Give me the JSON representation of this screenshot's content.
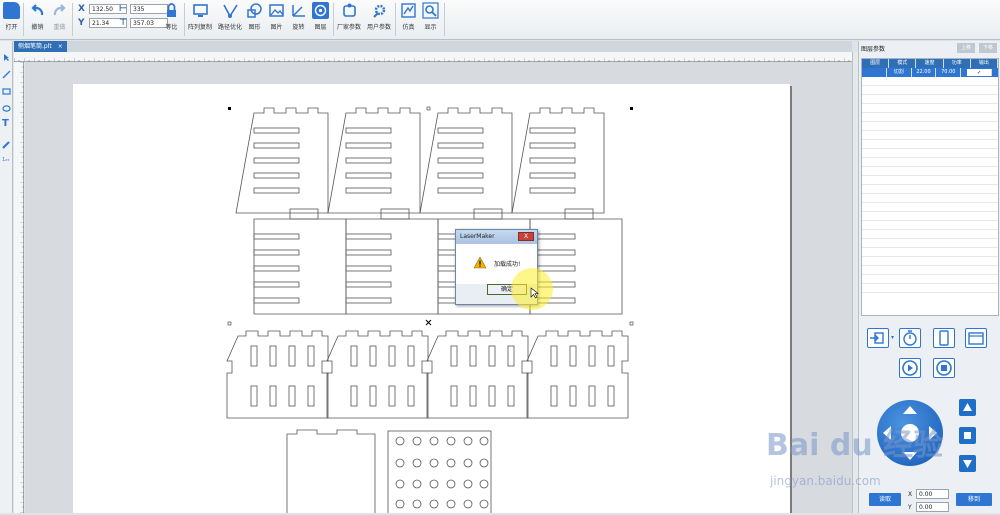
{
  "toolbar": {
    "open": "打开",
    "undo": "撤销",
    "redo": "重做",
    "x_value": "132.50",
    "y_value": "21.34",
    "w_value": "335",
    "h_value": "357.03",
    "lock": "等比",
    "array_copy": "阵列复制",
    "path_optimize": "路径优化",
    "shape": "图形",
    "image": "图片",
    "rotate": "旋转",
    "layer": "图层",
    "vendor_params": "厂家参数",
    "user_params": "用户参数",
    "simulate": "仿真",
    "display": "显示",
    "x_label": "X",
    "y_label": "Y",
    "w_label": "W",
    "h_label": "H"
  },
  "tab": {
    "name": "侧烟笔筒.plt",
    "close": "×"
  },
  "dialog": {
    "title": "LaserMaker",
    "message": "加载成功!",
    "ok": "确定",
    "close": "X"
  },
  "layer_panel": {
    "title": "图层参数",
    "up": "上移",
    "down": "下移",
    "headers": [
      "图层",
      "模式",
      "速度",
      "功率",
      "输出"
    ],
    "row": [
      "",
      "切割",
      "22.00",
      "70.00",
      "✓"
    ]
  },
  "controls": {
    "read": "读取",
    "move": "移到",
    "x_label": "X",
    "y_label": "Y",
    "x_value": "0.00",
    "y_value": "0.00"
  },
  "watermark": {
    "brand": "Bai du 经验",
    "url": "jingyan.baidu.com"
  },
  "colors": {
    "accent": "#2f76d2",
    "toolbar_bg": "#eef1f4"
  }
}
